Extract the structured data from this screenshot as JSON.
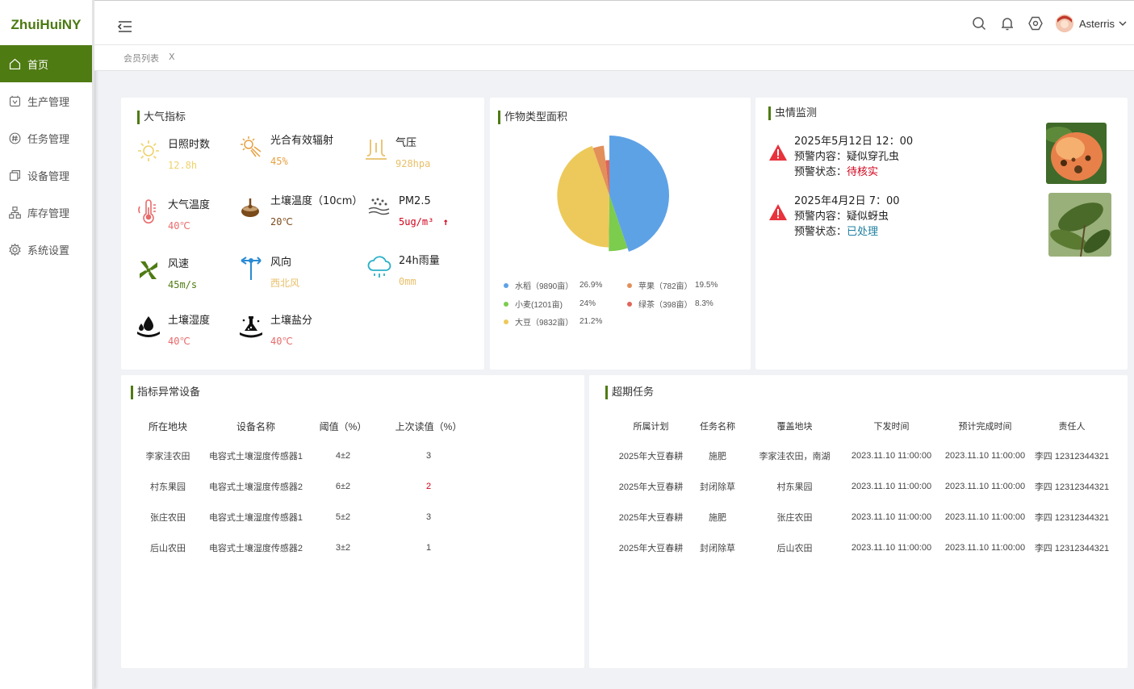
{
  "app": {
    "logo": "ZhuiHuiNY"
  },
  "sidebar": {
    "items": [
      {
        "label": "首页",
        "icon": "home-icon",
        "active": true
      },
      {
        "label": "生产管理",
        "icon": "production-icon"
      },
      {
        "label": "任务管理",
        "icon": "task-icon"
      },
      {
        "label": "设备管理",
        "icon": "device-icon"
      },
      {
        "label": "库存管理",
        "icon": "inventory-icon"
      },
      {
        "label": "系统设置",
        "icon": "settings-icon"
      }
    ]
  },
  "header": {
    "username": "Asterris"
  },
  "tabs": {
    "label": "会员列表",
    "close": "X"
  },
  "atmosphere": {
    "title": "大气指标",
    "metrics": [
      {
        "name": "日照时数",
        "value": "12.8h",
        "color": "#f0d26a",
        "icon": "sun-icon"
      },
      {
        "name": "光合有效辐射",
        "value": "45%",
        "color": "#e8a040",
        "icon": "radiation-icon"
      },
      {
        "name": "气压",
        "value": "928hpa",
        "color": "#e8c06a",
        "icon": "pressure-icon"
      },
      {
        "name": "大气温度",
        "value": "40℃",
        "color": "#e86a6a",
        "icon": "thermometer-icon"
      },
      {
        "name": "土壤温度（10cm）",
        "value": "20℃",
        "color": "#7a4a1a",
        "icon": "soil-temperature-icon"
      },
      {
        "name": "PM2.5",
        "value": "5ug/m³",
        "color": "#d0021b",
        "trend": "↑",
        "icon": "pm25-icon"
      },
      {
        "name": "风速",
        "value": "45m/s",
        "color": "#4f7b13",
        "icon": "wind-speed-icon"
      },
      {
        "name": "风向",
        "value": "西北风",
        "color": "#e8c06a",
        "icon": "wind-direction-icon"
      },
      {
        "name": "24h雨量",
        "value": "0mm",
        "color": "#e8c06a",
        "icon": "rain-icon"
      },
      {
        "name": "土壤湿度",
        "value": "40℃",
        "color": "#e86a6a",
        "icon": "soil-humidity-icon"
      },
      {
        "name": "土壤盐分",
        "value": "40℃",
        "color": "#e86a6a",
        "icon": "soil-salt-icon"
      }
    ]
  },
  "crops": {
    "title": "作物类型面积"
  },
  "chart_data": {
    "type": "pie",
    "title": "作物类型面积",
    "slices": [
      {
        "name": "水稻",
        "label": "水稻（9890亩）",
        "value": 9890,
        "percent": "26.9%",
        "color": "#5ea2e6"
      },
      {
        "name": "小麦",
        "label": "小麦(1201亩)",
        "value": 1201,
        "percent": "24%",
        "color": "#7ccc4e"
      },
      {
        "name": "大豆",
        "label": "大豆（9832亩）",
        "value": 9832,
        "percent": "21.2%",
        "color": "#ecc95a"
      },
      {
        "name": "苹果",
        "label": "苹果（782亩）",
        "value": 782,
        "percent": "19.5%",
        "color": "#e38f5a"
      },
      {
        "name": "绿茶",
        "label": "绿茶（398亩）",
        "value": 398,
        "percent": "8.3%",
        "color": "#e06558"
      }
    ]
  },
  "pests": {
    "title": "虫情监测",
    "alerts": [
      {
        "time": "2025年5月12日 12：00",
        "content_label": "预警内容：",
        "content": "疑似穿孔虫",
        "status_label": "预警状态：",
        "status": "待核实",
        "status_color": "#d0021b"
      },
      {
        "time": "2025年4月2日 7：00",
        "content_label": "预警内容：",
        "content": "疑似蚜虫",
        "status_label": "预警状态：",
        "status": "已处理",
        "status_color": "#1f7fa0"
      }
    ]
  },
  "devices": {
    "title": "指标异常设备",
    "headers": [
      "所在地块",
      "设备名称",
      "阈值（%）",
      "上次读值（%）"
    ],
    "rows": [
      [
        "李家洼农田",
        "电容式土壤湿度传感器1",
        "4±2",
        "3"
      ],
      [
        "村东果园",
        "电容式土壤湿度传感器2",
        "6±2",
        "2"
      ],
      [
        "张庄农田",
        "电容式土壤湿度传感器1",
        "5±2",
        "3"
      ],
      [
        "后山农田",
        "电容式土壤湿度传感器2",
        "3±2",
        "1"
      ]
    ],
    "alert_color": "#d0021b"
  },
  "tasks": {
    "title": "超期任务",
    "headers": [
      "所属计划",
      "任务名称",
      "覆盖地块",
      "下发时间",
      "预计完成时间",
      "责任人"
    ],
    "rows": [
      [
        "2025年大豆春耕",
        "施肥",
        "李家洼农田，南湖",
        "2023.11.10 11:00:00",
        "2023.11.10 11:00:00",
        "李四 12312344321"
      ],
      [
        "2025年大豆春耕",
        "封闭除草",
        "村东果园",
        "2023.11.10 11:00:00",
        "2023.11.10 11:00:00",
        "李四 12312344321"
      ],
      [
        "2025年大豆春耕",
        "施肥",
        "张庄农田",
        "2023.11.10 11:00:00",
        "2023.11.10 11:00:00",
        "李四 12312344321"
      ],
      [
        "2025年大豆春耕",
        "封闭除草",
        "后山农田",
        "2023.11.10 11:00:00",
        "2023.11.10 11:00:00",
        "李四 12312344321"
      ]
    ]
  }
}
